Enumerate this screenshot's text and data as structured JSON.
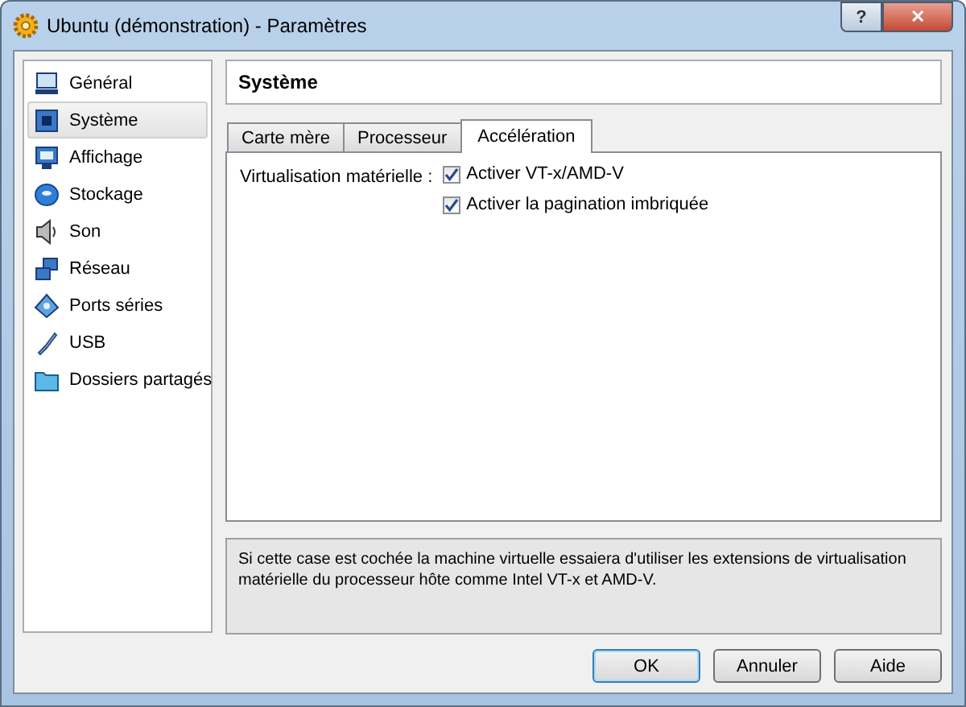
{
  "window": {
    "title": "Ubuntu (démonstration) - Paramètres",
    "help_button": "?",
    "close_button": "✕"
  },
  "sidebar": {
    "items": [
      {
        "label": "Général",
        "selected": false
      },
      {
        "label": "Système",
        "selected": true
      },
      {
        "label": "Affichage",
        "selected": false
      },
      {
        "label": "Stockage",
        "selected": false
      },
      {
        "label": "Son",
        "selected": false
      },
      {
        "label": "Réseau",
        "selected": false
      },
      {
        "label": "Ports séries",
        "selected": false
      },
      {
        "label": "USB",
        "selected": false
      },
      {
        "label": "Dossiers partagés",
        "selected": false
      }
    ]
  },
  "page_title": "Système",
  "tabs": [
    {
      "label": "Carte mère",
      "selected": false
    },
    {
      "label": "Processeur",
      "selected": false
    },
    {
      "label": "Accélération",
      "selected": true
    }
  ],
  "acceleration": {
    "label": "Virtualisation matérielle :",
    "options": [
      {
        "label": "Activer VT-x/AMD-V",
        "checked": true
      },
      {
        "label": "Activer la pagination imbriquée",
        "checked": true
      }
    ]
  },
  "description": "Si cette case est cochée la machine virtuelle essaiera d'utiliser les extensions de virtualisation matérielle du processeur hôte comme Intel VT-x et AMD-V.",
  "buttons": [
    {
      "label": "OK",
      "default": true
    },
    {
      "label": "Annuler",
      "default": false
    },
    {
      "label": "Aide",
      "default": false
    }
  ]
}
